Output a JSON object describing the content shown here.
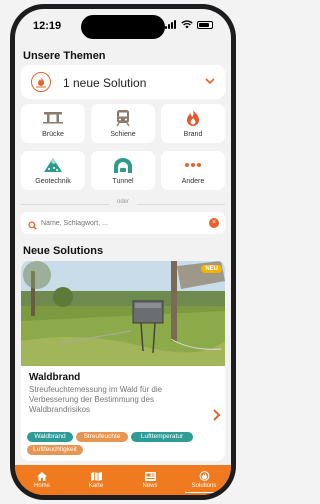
{
  "status": {
    "time": "12:19"
  },
  "header": {
    "title": "Unsere Themen"
  },
  "solution_select": {
    "label": "1 neue Solution",
    "icon": "wildfire-icon"
  },
  "themes": [
    {
      "label": "Brücke",
      "icon": "bridge-icon"
    },
    {
      "label": "Schiene",
      "icon": "train-icon"
    },
    {
      "label": "Brand",
      "icon": "fire-icon"
    },
    {
      "label": "Geotechnik",
      "icon": "geotechnics-icon"
    },
    {
      "label": "Tunnel",
      "icon": "tunnel-icon"
    },
    {
      "label": "Andere",
      "icon": "more-icon"
    }
  ],
  "divider": {
    "label": "oder"
  },
  "search": {
    "placeholder": "Name, Schlagwort, ..."
  },
  "new_solutions": {
    "title": "Neue Solutions",
    "card": {
      "badge": "NEU",
      "title": "Waldbrand",
      "description": "Streufeuchtemessung im Wald für die Verbesserung der Bestimmung des Waldbrandrisikos",
      "tags": [
        "Waldbrand",
        "Streufeuchte",
        "Lufttemperatur",
        "Luftfeuchtigkeit"
      ]
    }
  },
  "tabbar": [
    {
      "label": "Home",
      "icon": "home-icon"
    },
    {
      "label": "Karte",
      "icon": "map-icon"
    },
    {
      "label": "News",
      "icon": "news-icon"
    },
    {
      "label": "Solutions",
      "icon": "solutions-icon",
      "active": true
    }
  ],
  "colors": {
    "accent": "#f07a1f",
    "teal_tag": "#2e9b97",
    "orange_tag": "#e89552",
    "icon_gray": "#8a7b6e",
    "icon_teal": "#2f9c8a"
  }
}
